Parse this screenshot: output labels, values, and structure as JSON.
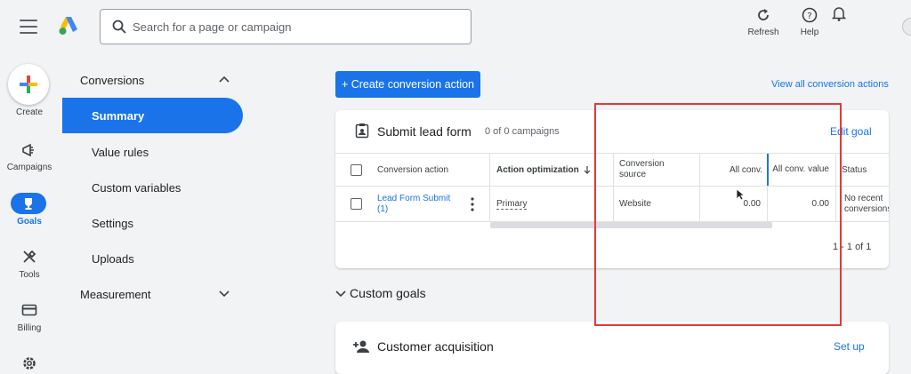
{
  "search": {
    "placeholder": "Search for a page or campaign"
  },
  "topbar": {
    "refresh": "Refresh",
    "help": "Help"
  },
  "rail": {
    "create": "Create",
    "campaigns": "Campaigns",
    "goals": "Goals",
    "tools": "Tools",
    "billing": "Billing"
  },
  "nav": {
    "conversions": "Conversions",
    "items": [
      "Summary",
      "Value rules",
      "Custom variables",
      "Settings",
      "Uploads"
    ],
    "measurement": "Measurement"
  },
  "main": {
    "create_action": "+ Create conversion action",
    "view_all": "View all conversion actions",
    "card": {
      "title": "Submit lead form",
      "subtitle": "0 of 0 campaigns",
      "edit": "Edit goal",
      "columns": {
        "action": "Conversion action",
        "optimization": "Action optimization",
        "source": "Conversion source",
        "all_conv": "All conv.",
        "all_conv_value": "All conv. value",
        "status": "Status"
      },
      "row": {
        "action": "Lead Form Submit (1)",
        "optimization": "Primary",
        "source": "Website",
        "all_conv": "0.00",
        "all_conv_value": "0.00",
        "status": "No recent conversions"
      },
      "pager": "1 - 1 of 1"
    },
    "custom_goals": "Custom goals",
    "card2": {
      "title": "Customer acquisition",
      "setup": "Set up"
    }
  },
  "colors": {
    "accent": "#1a73e8",
    "highlight": "#e53935"
  }
}
